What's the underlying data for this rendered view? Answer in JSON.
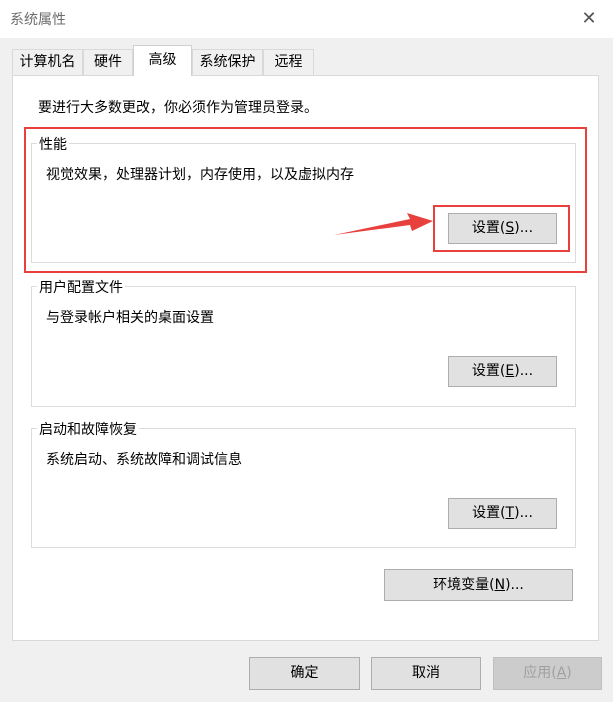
{
  "window": {
    "title": "系统属性",
    "close_glyph": "✕"
  },
  "tabs": [
    {
      "label": "计算机名",
      "active": false
    },
    {
      "label": "硬件",
      "active": false
    },
    {
      "label": "高级",
      "active": true
    },
    {
      "label": "系统保护",
      "active": false
    },
    {
      "label": "远程",
      "active": false
    }
  ],
  "notice": "要进行大多数更改，你必须作为管理员登录。",
  "performance": {
    "title": "性能",
    "description": "视觉效果，处理器计划，内存使用，以及虚拟内存",
    "button": {
      "prefix": "设置(",
      "key": "S",
      "suffix": ")..."
    }
  },
  "user_profiles": {
    "title": "用户配置文件",
    "description": "与登录帐户相关的桌面设置",
    "button": {
      "prefix": "设置(",
      "key": "E",
      "suffix": ")..."
    }
  },
  "startup_recovery": {
    "title": "启动和故障恢复",
    "description": "系统启动、系统故障和调试信息",
    "button": {
      "prefix": "设置(",
      "key": "T",
      "suffix": ")..."
    }
  },
  "env_vars_button": {
    "prefix": "环境变量(",
    "key": "N",
    "suffix": ")..."
  },
  "footer": {
    "ok": "确定",
    "cancel": "取消",
    "apply": {
      "prefix": "应用(",
      "key": "A",
      "suffix": ")"
    }
  },
  "annotation": {
    "color": "#e8403d"
  }
}
